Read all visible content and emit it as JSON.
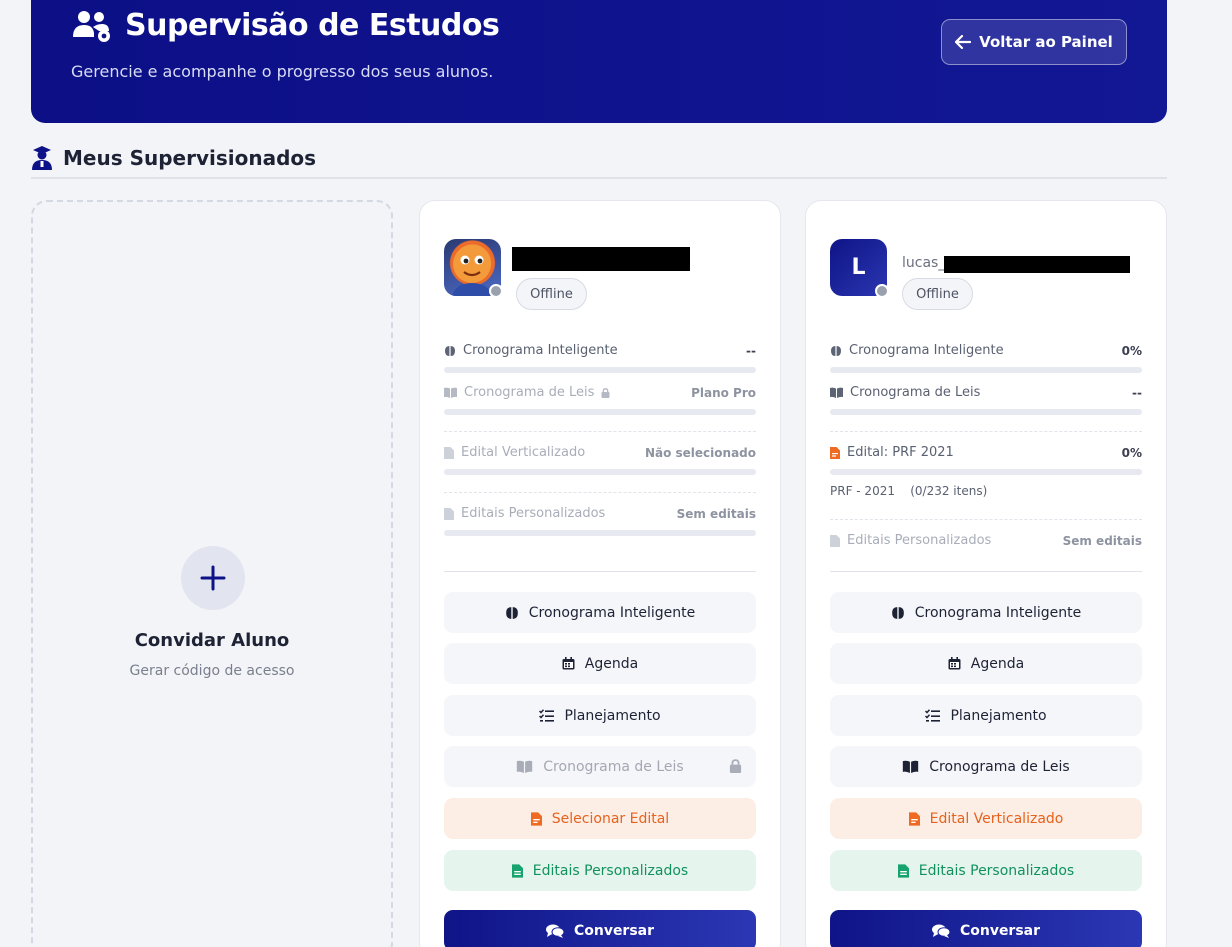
{
  "header": {
    "title": "Supervisão de Estudos",
    "subtitle": "Gerencie e acompanhe o progresso dos seus alunos.",
    "back_label": "Voltar ao Painel"
  },
  "section": {
    "title": "Meus Supervisionados"
  },
  "invite": {
    "title": "Convidar Aluno",
    "subtitle": "Gerar código de acesso"
  },
  "cards": [
    {
      "name_prefix": "",
      "status": "Offline",
      "progress": {
        "cronograma": {
          "label": "Cronograma Inteligente",
          "value": "--"
        },
        "leis": {
          "label": "Cronograma de Leis",
          "value": "Plano Pro"
        },
        "edital": {
          "label": "Edital Verticalizado",
          "value": "Não selecionado"
        },
        "personalizados": {
          "label": "Editais Personalizados",
          "value": "Sem editais"
        }
      },
      "buttons": {
        "cronograma": "Cronograma Inteligente",
        "agenda": "Agenda",
        "planejamento": "Planejamento",
        "leis": "Cronograma de Leis",
        "edital": "Selecionar Edital",
        "personalizados": "Editais Personalizados",
        "chat": "Conversar"
      }
    },
    {
      "avatar_letter": "L",
      "name_prefix": "lucas_",
      "status": "Offline",
      "progress": {
        "cronograma": {
          "label": "Cronograma Inteligente",
          "value": "0%"
        },
        "leis": {
          "label": "Cronograma de Leis",
          "value": "--"
        },
        "edital": {
          "label": "Edital: PRF 2021",
          "value": "0%",
          "detail": "PRF - 2021    (0/232 itens)"
        },
        "personalizados": {
          "label": "Editais Personalizados",
          "value": "Sem editais"
        }
      },
      "buttons": {
        "cronograma": "Cronograma Inteligente",
        "agenda": "Agenda",
        "planejamento": "Planejamento",
        "leis": "Cronograma de Leis",
        "edital": "Edital Verticalizado",
        "personalizados": "Editais Personalizados",
        "chat": "Conversar"
      }
    }
  ]
}
